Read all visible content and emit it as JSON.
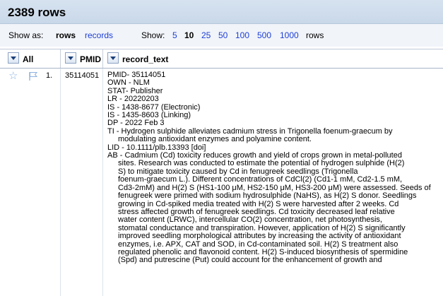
{
  "header": {
    "title": "2389 rows"
  },
  "viewbar": {
    "show_as_label": "Show as:",
    "modes": [
      "rows",
      "records"
    ],
    "active_mode": "rows",
    "show_label": "Show:",
    "counts": [
      "5",
      "10",
      "25",
      "50",
      "100",
      "500",
      "1000"
    ],
    "active_count": "10",
    "rows_suffix": "rows"
  },
  "columns": {
    "all": "All",
    "pmid": "PMID",
    "record_text": "record_text"
  },
  "row": {
    "number": "1.",
    "pmid": "35114051",
    "record_lines": [
      "PMID- 35114051",
      "OWN - NLM",
      "STAT- Publisher",
      "LR  - 20220203",
      "IS  - 1438-8677 (Electronic)",
      "IS  - 1435-8603 (Linking)",
      "DP  - 2022 Feb 3",
      "TI  - Hydrogen sulphide alleviates cadmium stress in Trigonella foenum-graecum by",
      "      modulating antioxidant enzymes and polyamine content.",
      "LID - 10.1111/plb.13393 [doi]",
      "AB  - Cadmium (Cd) toxicity reduces growth and yield of crops grown in metal-polluted",
      "      sites. Research was conducted to estimate the potential of hydrogen sulphide (H(2)",
      "      S) to mitigate toxicity caused by Cd in fenugreek seedlings (Trigonella",
      "      foenum-graecum L.). Different concentrations of CdCl(2) (Cd1-1 mM, Cd2-1.5 mM,",
      "      Cd3-2mM) and H(2) S (HS1-100 μM, HS2-150 μM, HS3-200 μM) were assessed. Seeds of",
      "      fenugreek were primed with sodium hydrosulphide (NaHS), as H(2) S donor. Seedlings",
      "      growing in Cd-spiked media treated with H(2) S were harvested after 2 weeks. Cd",
      "      stress affected growth of fenugreek seedlings. Cd toxicity decreased leaf relative",
      "      water content (LRWC), intercellular CO(2) concentration, net photosynthesis,",
      "      stomatal conductance and transpiration. However, application of H(2) S significantly",
      "      improved seedling morphological attributes by increasing the activity of antioxidant",
      "      enzymes, i.e. APX, CAT and SOD, in Cd-contaminated soil. H(2) S treatment also",
      "      regulated phenolic and flavonoid content. H(2) S-induced biosynthesis of spermidine",
      "      (Spd) and putrescine (Put) could account for the enhancement of growth and"
    ]
  }
}
